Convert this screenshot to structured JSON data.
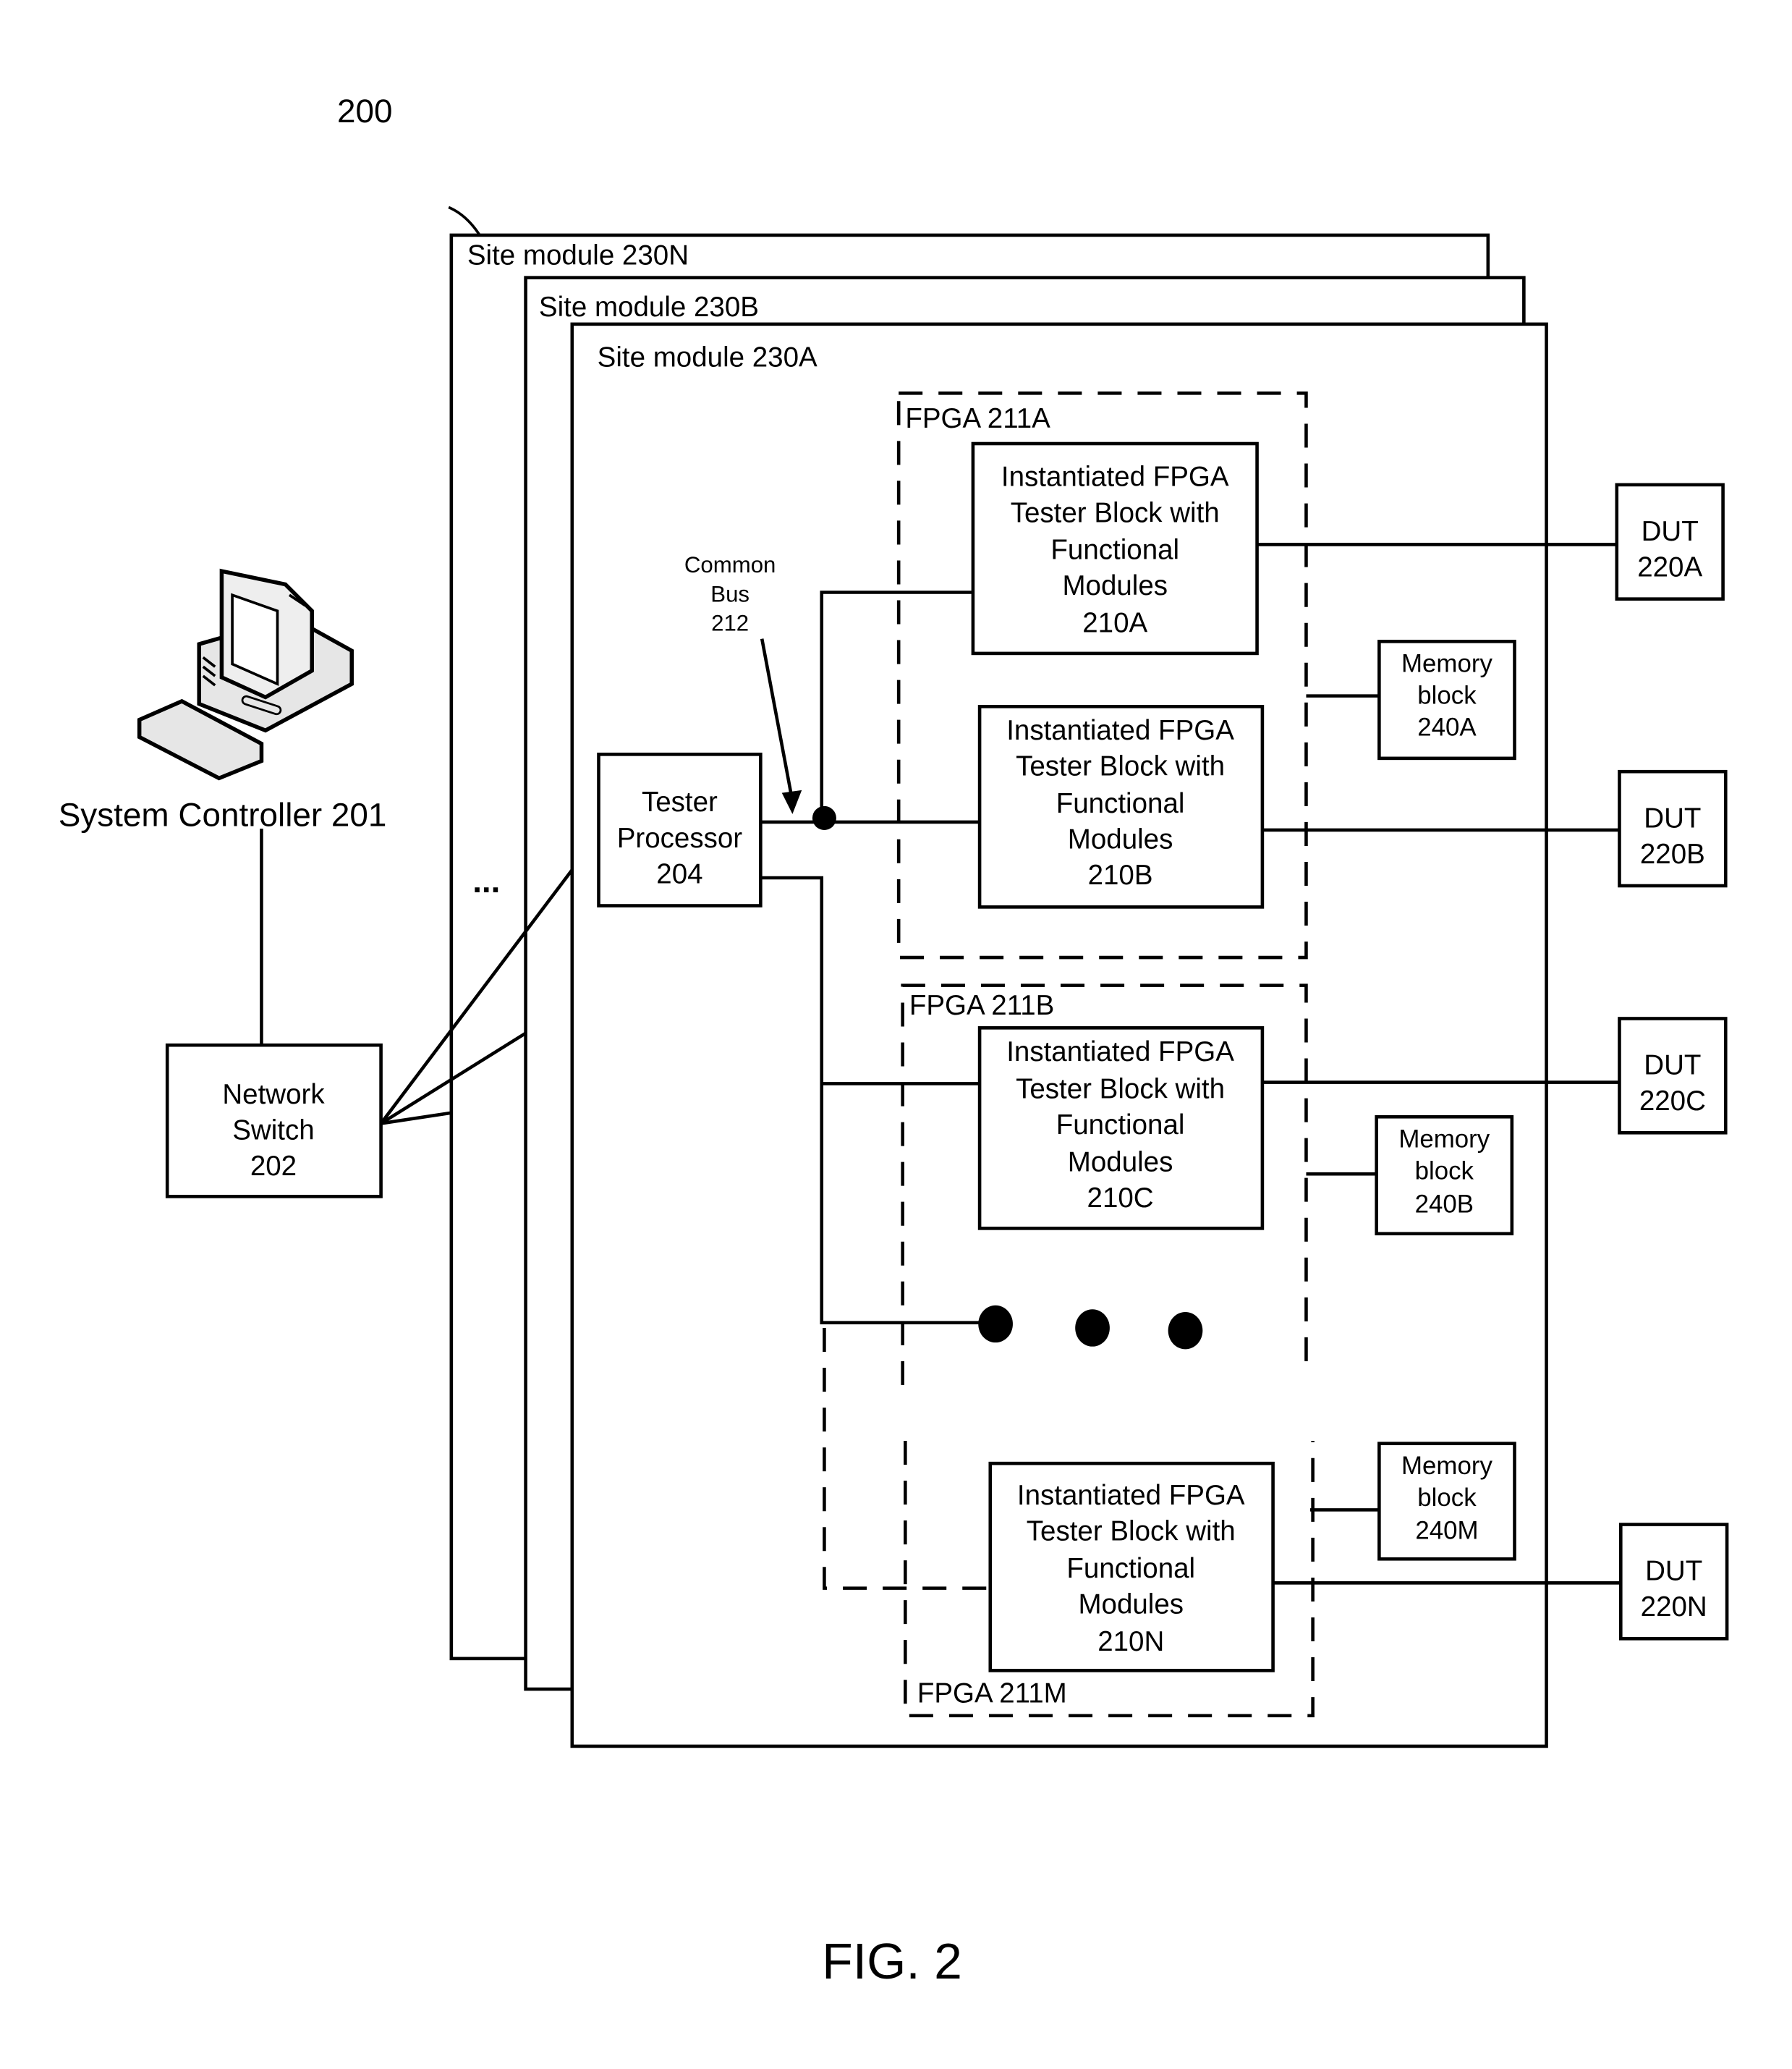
{
  "figure": {
    "reference_number": "200",
    "caption": "FIG. 2"
  },
  "system_controller": {
    "label": "System Controller 201",
    "icon": "desktop-computer-icon"
  },
  "network_switch": {
    "lines": [
      "Network",
      "Switch",
      "202"
    ]
  },
  "site_modules": [
    {
      "label": "Site module 230N"
    },
    {
      "label": "Site module 230B"
    },
    {
      "label": "Site module 230A"
    }
  ],
  "ellipsis": "...",
  "tester_processor": {
    "lines": [
      "Tester",
      "Processor",
      "204"
    ]
  },
  "common_bus": {
    "lines": [
      "Common",
      "Bus",
      "212"
    ]
  },
  "fpgas": [
    {
      "label": "FPGA 211A"
    },
    {
      "label": "FPGA 211B"
    },
    {
      "label": "FPGA 211M"
    }
  ],
  "tester_blocks": [
    {
      "lines": [
        "Instantiated FPGA",
        "Tester Block with",
        "Functional",
        "Modules",
        "210A"
      ]
    },
    {
      "lines": [
        "Instantiated FPGA",
        "Tester Block with",
        "Functional",
        "Modules",
        "210B"
      ]
    },
    {
      "lines": [
        "Instantiated FPGA",
        "Tester Block with",
        "Functional",
        "Modules",
        "210C"
      ]
    },
    {
      "lines": [
        "Instantiated FPGA",
        "Tester Block with",
        "Functional",
        "Modules",
        "210N"
      ]
    }
  ],
  "memory_blocks": [
    {
      "lines": [
        "Memory",
        "block",
        "240A"
      ]
    },
    {
      "lines": [
        "Memory",
        "block",
        "240B"
      ]
    },
    {
      "lines": [
        "Memory",
        "block",
        "240M"
      ]
    }
  ],
  "duts": [
    {
      "lines": [
        "DUT",
        "220A"
      ]
    },
    {
      "lines": [
        "DUT",
        "220B"
      ]
    },
    {
      "lines": [
        "DUT",
        "220C"
      ]
    },
    {
      "lines": [
        "DUT",
        "220N"
      ]
    }
  ]
}
